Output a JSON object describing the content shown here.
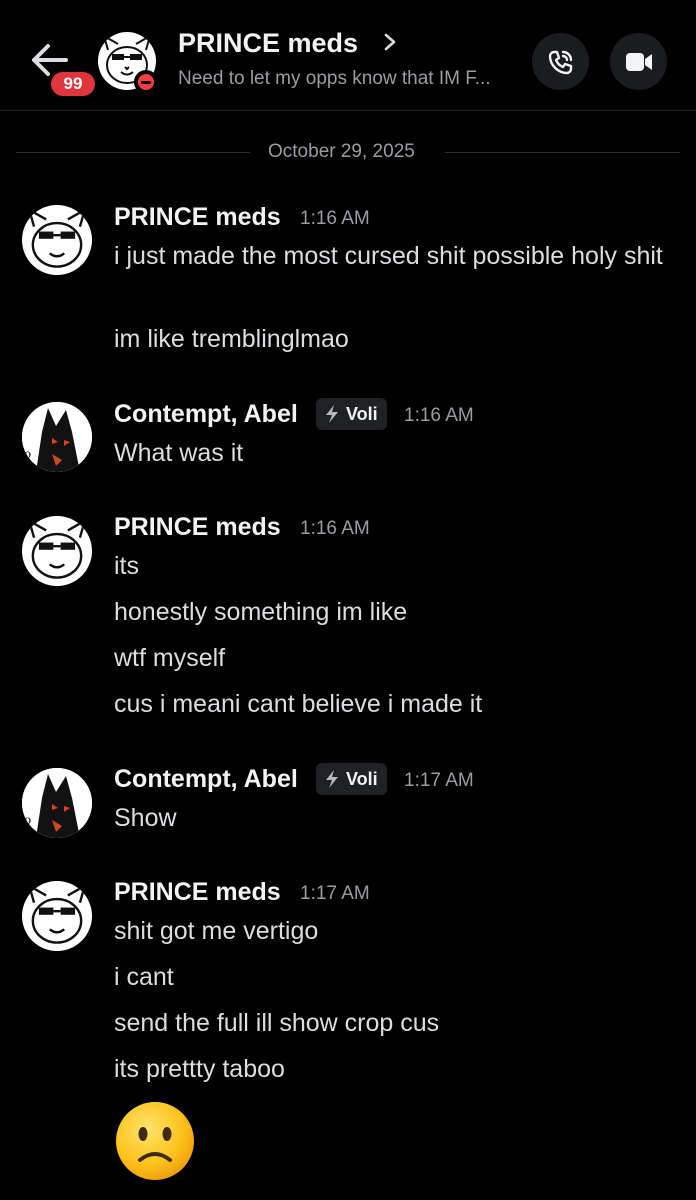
{
  "header": {
    "name": "PRINCE meds",
    "status": "Need to let my opps know that IM F...",
    "badge": "99"
  },
  "date_divider": "October 29, 2025",
  "messages": [
    {
      "author": "PRINCE meds",
      "time": "1:16 AM",
      "lines": [
        "i just made the most cursed shit possible holy shit",
        "im like tremblinglmao"
      ]
    },
    {
      "author": "Contempt, Abel",
      "tag": "Voli",
      "time": "1:16 AM",
      "lines": [
        "What was it"
      ]
    },
    {
      "author": "PRINCE meds",
      "time": "1:16 AM",
      "lines": [
        "its",
        "honestly something im like",
        "wtf myself",
        "cus i meani cant believe i made it"
      ]
    },
    {
      "author": "Contempt, Abel",
      "tag": "Voli",
      "time": "1:17 AM",
      "lines": [
        "Show"
      ]
    },
    {
      "author": "PRINCE meds",
      "time": "1:17 AM",
      "lines": [
        "shit got me vertigo",
        "i cant",
        "send the full ill show crop cus",
        "its prettty taboo"
      ],
      "emoji": "slightly-frowning-face"
    }
  ],
  "colors": {
    "background": "#000000",
    "badge": "#e0353d",
    "dnd": "#f23f43",
    "muted_text": "#9b9ca3",
    "tag_icon": "#b5bac1"
  }
}
